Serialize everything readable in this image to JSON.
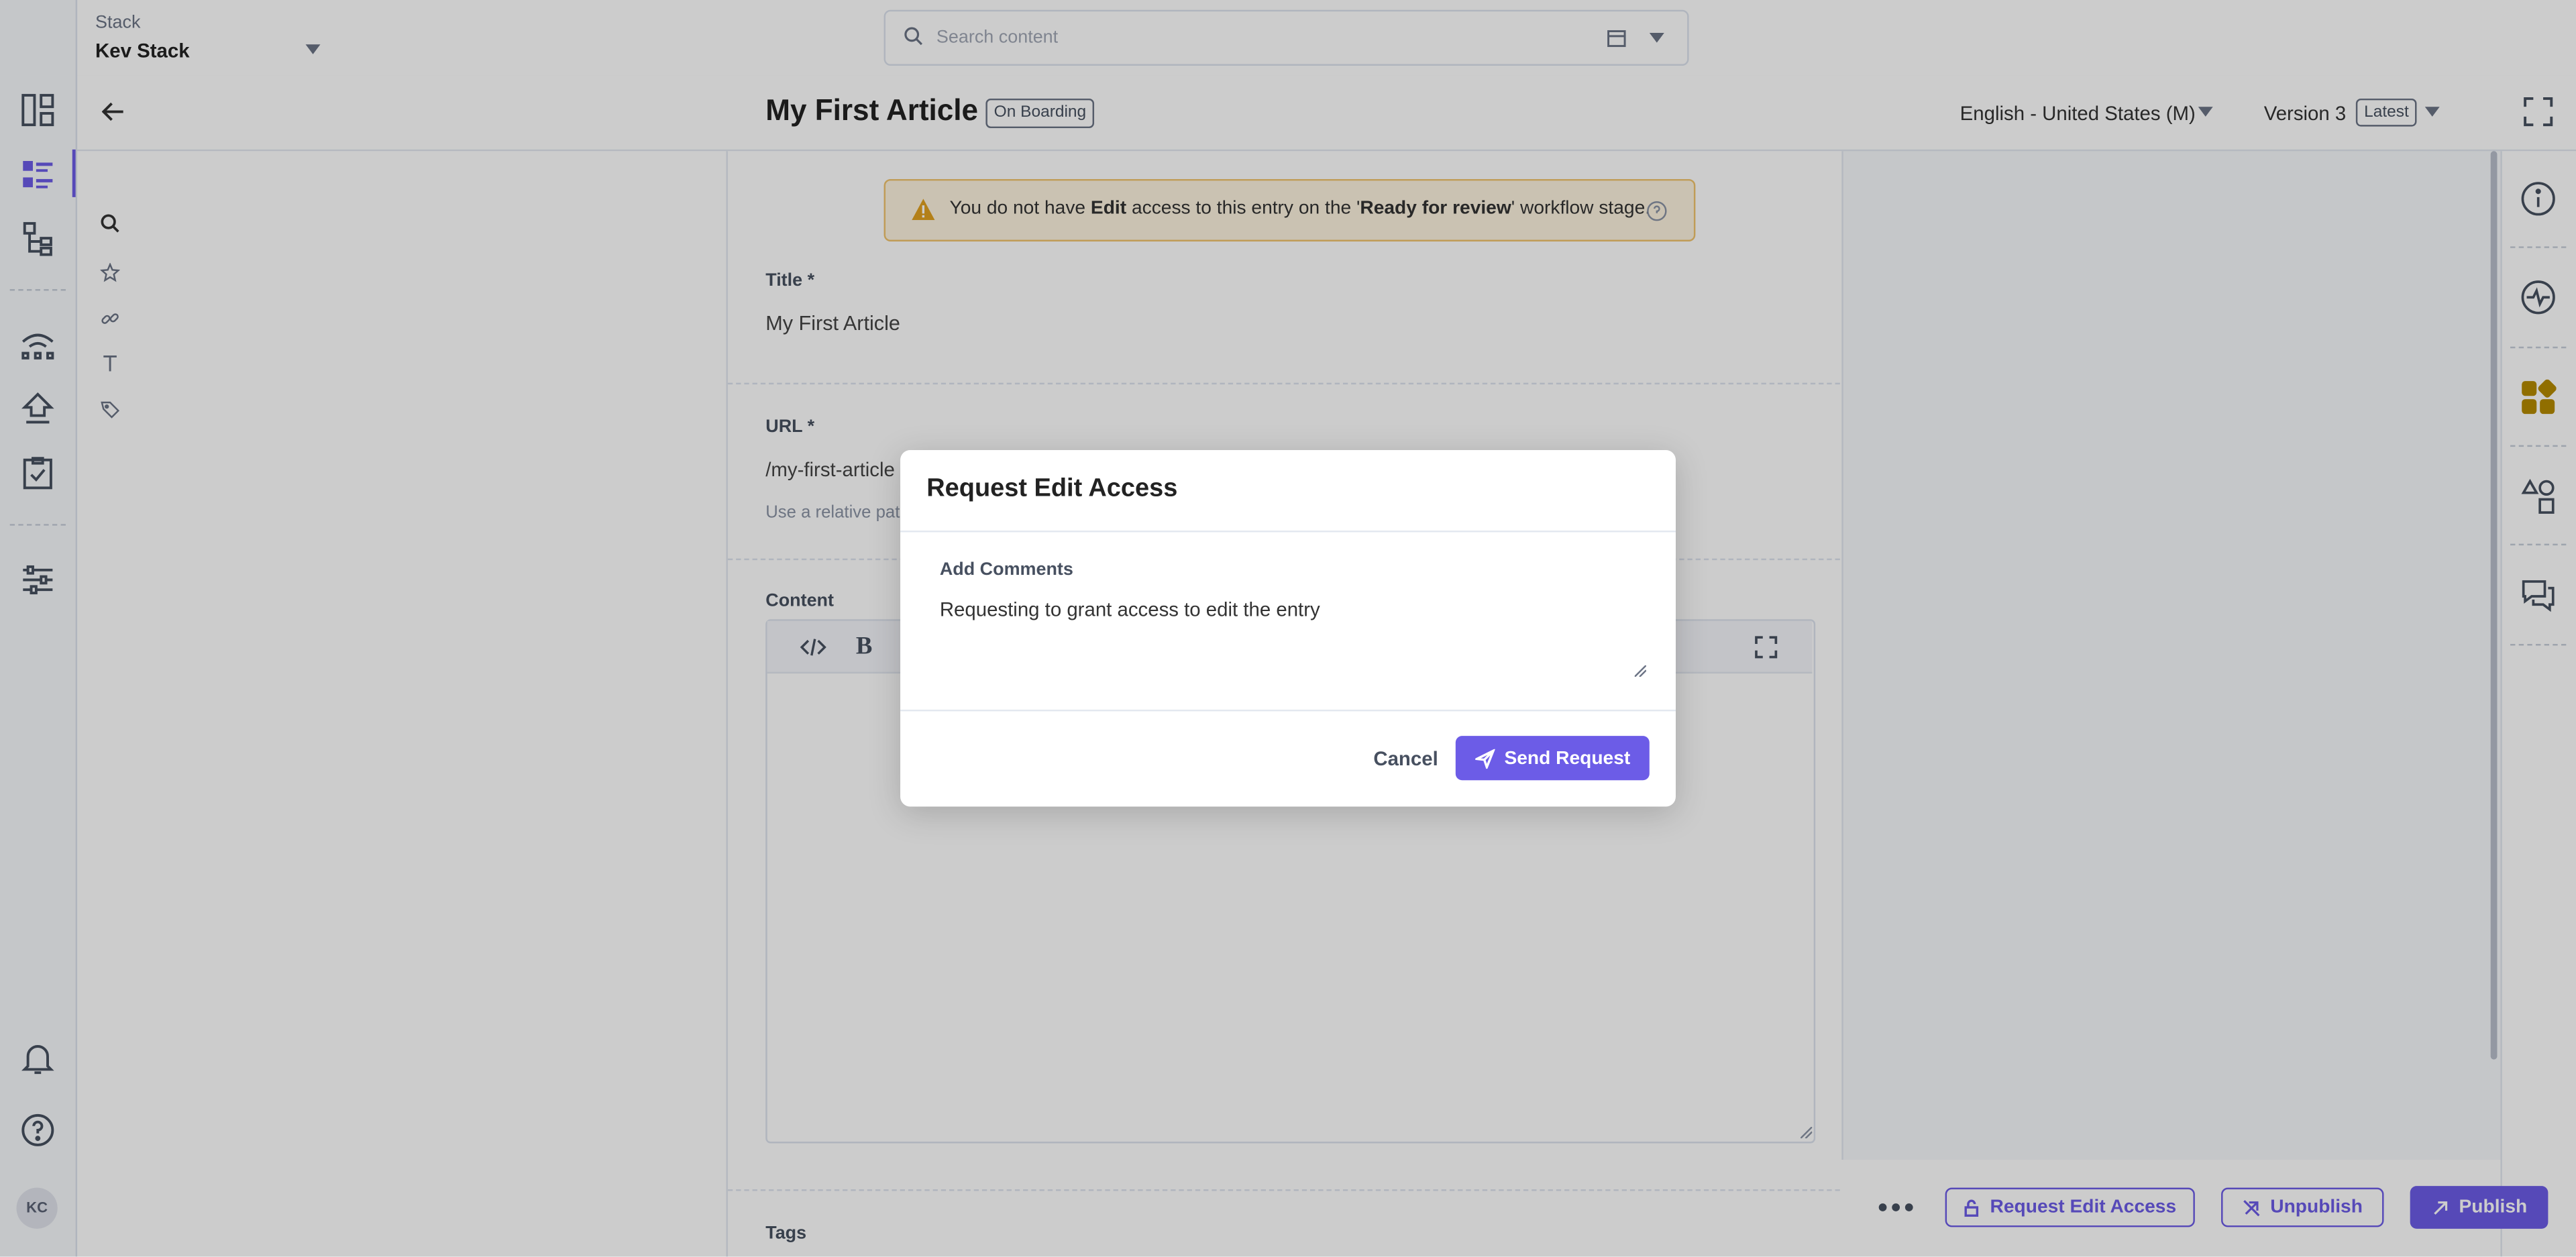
{
  "topbar": {
    "stack_label": "Stack",
    "stack_name": "Kev Stack",
    "search_placeholder": "Search content"
  },
  "entry": {
    "title": "My First Article",
    "workflow_badge": "On Boarding",
    "locale": "English - United States (M)",
    "version": "Version 3",
    "version_badge": "Latest"
  },
  "warning": {
    "prefix": "You do not have ",
    "bold1": "Edit",
    "middle": " access to this entry on the '",
    "bold2": "Ready for review",
    "suffix": "' workflow stage."
  },
  "fields": {
    "title_label": "Title *",
    "title_value": "My First Article",
    "url_label": "URL *",
    "url_value": "/my-first-article",
    "url_help": "Use a relative path",
    "content_label": "Content",
    "tags_label": "Tags"
  },
  "modal": {
    "title": "Request Edit Access",
    "comments_label": "Add Comments",
    "comments_value": "Requesting to grant access to edit the entry",
    "cancel": "Cancel",
    "send": "Send Request"
  },
  "footer": {
    "request_edit": "Request Edit Access",
    "unpublish": "Unpublish",
    "publish": "Publish"
  },
  "user": {
    "initials": "KC"
  },
  "colors": {
    "accent": "#6c5ce7",
    "warning_bg": "#fdf3df",
    "warning_border": "#f0c36d"
  }
}
